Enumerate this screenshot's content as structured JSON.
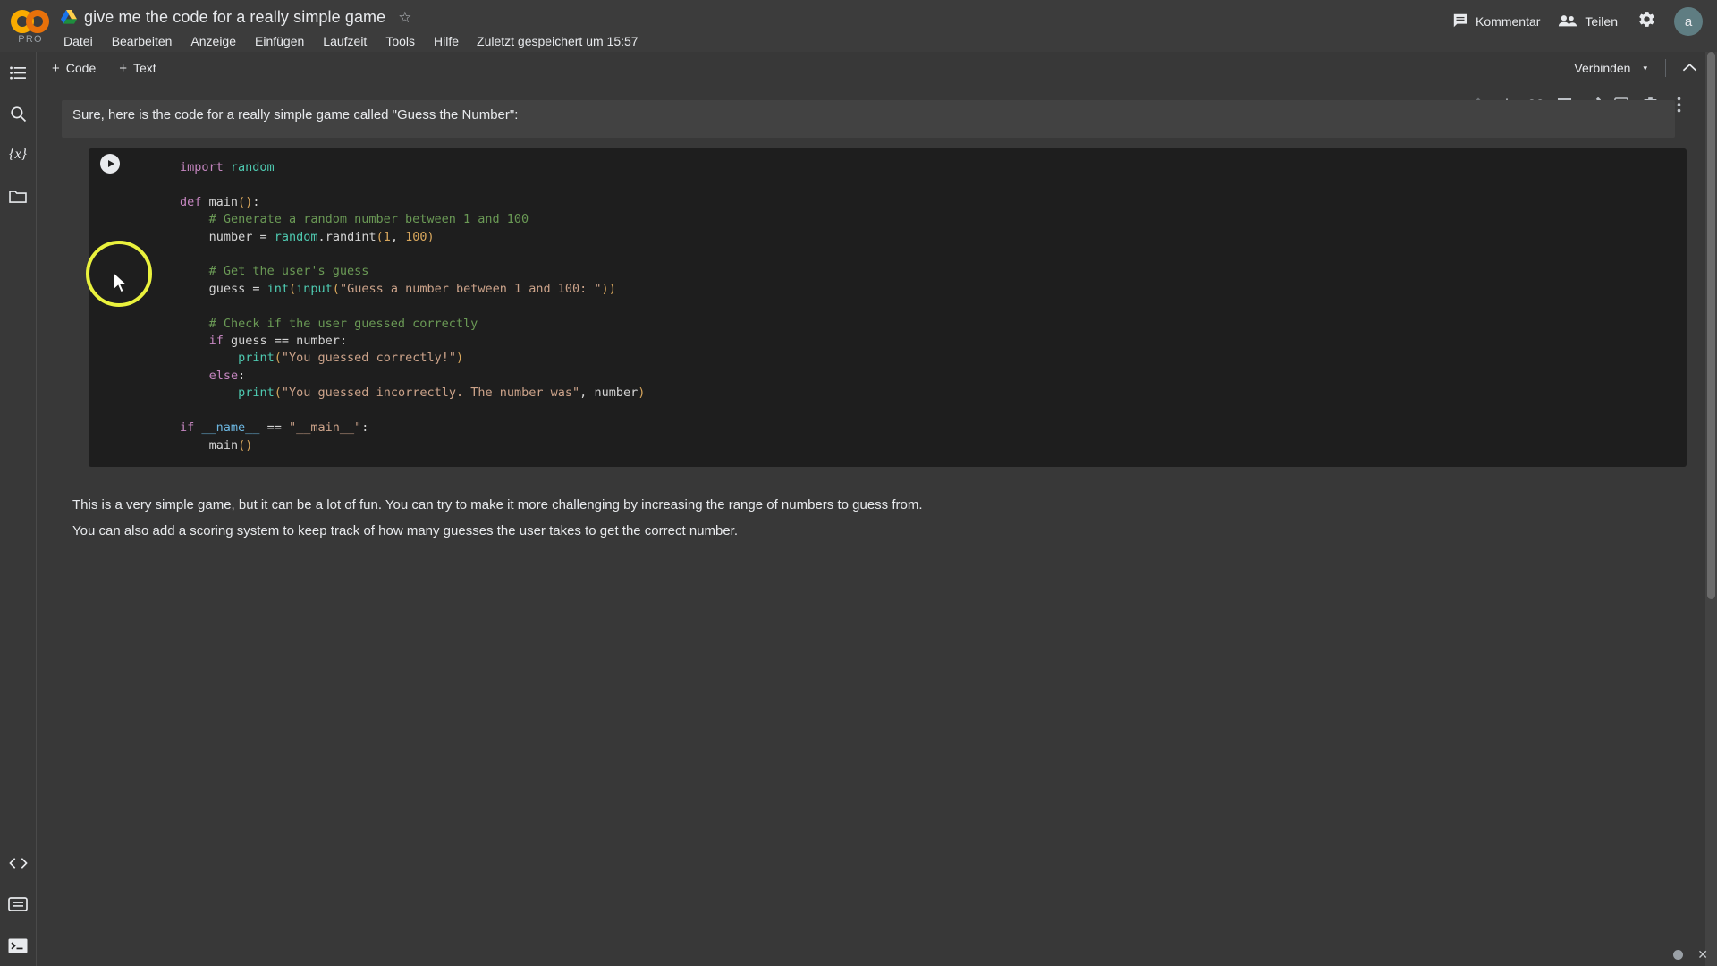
{
  "header": {
    "logo": {
      "name": "colab-logo",
      "tier_label": "PRO",
      "color_left": "#f9ab00",
      "color_right": "#e8710a"
    },
    "drive_icon": "google-drive-icon",
    "doc_title": "give me the code for a really simple game",
    "star_icon": "☆",
    "menu": [
      {
        "label": "Datei"
      },
      {
        "label": "Bearbeiten"
      },
      {
        "label": "Anzeige"
      },
      {
        "label": "Einfügen"
      },
      {
        "label": "Laufzeit"
      },
      {
        "label": "Tools"
      },
      {
        "label": "Hilfe"
      }
    ],
    "saved_note": "Zuletzt gespeichert um 15:57",
    "actions": {
      "comment_label": "Kommentar",
      "comment_icon": "comment-icon",
      "share_label": "Teilen",
      "share_icon": "people-icon",
      "settings_icon": "gear-icon",
      "avatar_initial": "a",
      "avatar_color": "#5f7d82"
    }
  },
  "toolbar": {
    "add_code_label": "Code",
    "add_text_label": "Text",
    "plus": "+",
    "connect_label": "Verbinden",
    "connect_caret": "▾",
    "collapse_icon": "chevron-up-icon"
  },
  "rail": {
    "top_items": [
      {
        "name": "table-of-contents-icon",
        "glyph": "toc"
      },
      {
        "name": "search-icon",
        "glyph": "search"
      },
      {
        "name": "variables-icon",
        "glyph": "{x}"
      },
      {
        "name": "files-folder-icon",
        "glyph": "folder"
      }
    ],
    "bottom_items": [
      {
        "name": "code-snippets-icon",
        "glyph": "<>"
      },
      {
        "name": "command-palette-icon",
        "glyph": "panel"
      },
      {
        "name": "terminal-icon",
        "glyph": ">_"
      }
    ]
  },
  "cell_toolbar": [
    {
      "name": "move-cell-up-icon",
      "glyph": "↑",
      "dim": true
    },
    {
      "name": "move-cell-down-icon",
      "glyph": "↓",
      "dim": false
    },
    {
      "name": "link-to-cell-icon",
      "glyph": "link",
      "dim": false
    },
    {
      "name": "add-comment-icon",
      "glyph": "comment",
      "dim": false
    },
    {
      "name": "edit-cell-icon",
      "glyph": "pencil",
      "dim": false
    },
    {
      "name": "mirror-cell-icon",
      "glyph": "open-in-new",
      "dim": false
    },
    {
      "name": "delete-cell-icon",
      "glyph": "trash",
      "dim": false
    },
    {
      "name": "more-cell-actions-icon",
      "glyph": "kebab",
      "dim": false
    }
  ],
  "content": {
    "intro_text": "Sure, here is the code for a really simple game called \"Guess the Number\":",
    "outro_line_1": "This is a very simple game, but it can be a lot of fun. You can try to make it more challenging by increasing the range of numbers to guess from.",
    "outro_line_2": "You can also add a scoring system to keep track of how many guesses the user takes to get the correct number."
  },
  "code_cell": {
    "language": "python",
    "run_button": "run-cell-button",
    "source": "import random\n\ndef main():\n    # Generate a random number between 1 and 100\n    number = random.randint(1, 100)\n\n    # Get the user's guess\n    guess = int(input(\"Guess a number between 1 and 100: \"))\n\n    # Check if the user guessed correctly\n    if guess == number:\n        print(\"You guessed correctly!\")\n    else:\n        print(\"You guessed incorrectly. The number was\", number)\n\nif __name__ == \"__main__\":\n    main()",
    "syntax_colors": {
      "keyword": "#c586c0",
      "builtin": "#4ec9b0",
      "comment": "#6a9955",
      "string": "#cca38a",
      "number": "#d7a65c",
      "dunder": "#6cb6e0",
      "default": "#d4d4d4",
      "background": "#1e1e1e"
    }
  },
  "annotation": {
    "highlight_shape": "circle",
    "highlight_color": "#eaf23d",
    "cursor": "mouse-pointer"
  },
  "status_bar": {
    "dot_icon": "resource-status-dot",
    "close_icon": "✕"
  }
}
